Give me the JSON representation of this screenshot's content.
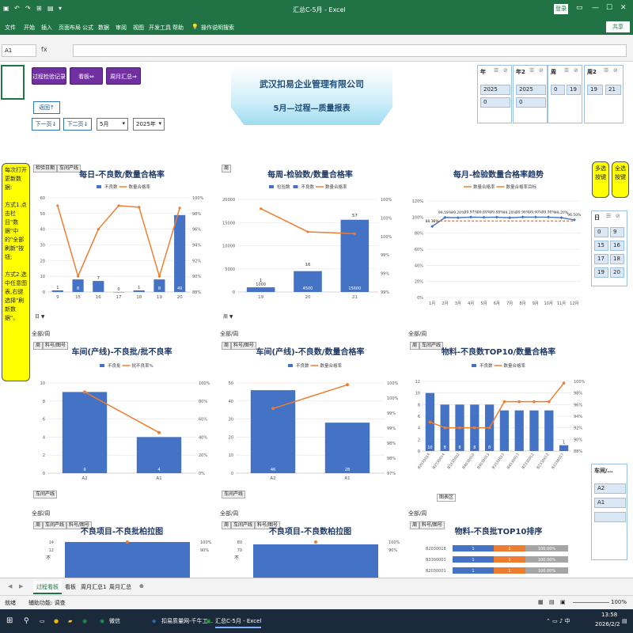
{
  "window": {
    "title": "汇总C-5月 - Excel",
    "login_label": "登录",
    "share_label": "共享"
  },
  "ribbon": {
    "tabs": [
      "文件",
      "开始",
      "插入",
      "页面布局",
      "公式",
      "数据",
      "审阅",
      "视图",
      "开发工具",
      "帮助"
    ],
    "tell_me": "操作说明搜索"
  },
  "formula_bar": {
    "name_box": "A1",
    "fx": "fx",
    "value": ""
  },
  "buttons": {
    "process": "过程检验记录",
    "board": "看板⇔",
    "monthly": "周月汇总⇒",
    "back": "返回↑",
    "next_page": "下一页↓",
    "next_page2": "下二页↓"
  },
  "selects": {
    "month": "5月",
    "year": "2025年"
  },
  "banner": {
    "company": "武汉扣易企业管理有限公司",
    "subtitle": "5月—过程—质量报表"
  },
  "slicers": {
    "year": {
      "header": "年",
      "items": [
        "2025",
        "0"
      ]
    },
    "year2": {
      "header": "年2",
      "items": [
        "2025",
        "0"
      ]
    },
    "week": {
      "header": "周",
      "items": [
        "0",
        "19"
      ]
    },
    "week2": {
      "header": "周2",
      "items": [
        "19",
        "21"
      ]
    },
    "right_week": {
      "header": "日",
      "items": [
        [
          "0",
          "9"
        ],
        [
          "15",
          "16"
        ],
        [
          "17",
          "18"
        ],
        [
          "19",
          "20"
        ]
      ]
    },
    "workshop": {
      "header": "车间/…",
      "items": [
        "A2",
        "A1",
        ""
      ]
    }
  },
  "notes": {
    "left": "每次打开更新数据:\n\n方式1.点击栏目\"数据\"中的\"全部刷新\"按钮;\n\n方式2.选中任意图表,右键选择\"刷新数据\"。",
    "multi": "多选按键",
    "all": "全选按键"
  },
  "field_buttons": {
    "date": "检验日期",
    "workshop": "车间产线",
    "week": "周",
    "material": "料号/图号",
    "all_week": "全部/周"
  },
  "chart_tooltip": "图表区",
  "sheet_tabs": [
    "过程看板",
    "看板",
    "周月汇总1",
    "周月汇总"
  ],
  "active_tab": "过程看板",
  "status": {
    "ready": "就绪",
    "accessibility": "辅助功能: 调查",
    "zoom": "100%"
  },
  "taskbar": {
    "apps": [
      "微信",
      "扣易质量网-千牛工...",
      "汇总C-5月 - Excel"
    ],
    "time": "13:58",
    "date": "2026/2/2"
  },
  "colors": {
    "bar": "#4472c4",
    "line": "#ed7d31",
    "excel_green": "#217346",
    "purple": "#7030a0"
  },
  "chart_data": [
    {
      "type": "bar",
      "title": "每日-不良数/数量合格率",
      "series": [
        {
          "name": "不良数",
          "values": [
            1,
            8,
            7,
            0,
            1,
            8,
            49
          ]
        },
        {
          "name": "数量合格率",
          "values": [
            0.99,
            0.9,
            0.96,
            0.99,
            0.988,
            0.9,
            0.987
          ]
        }
      ],
      "categories": [
        "9",
        "15",
        "16",
        "17",
        "18",
        "19",
        "20"
      ],
      "ylim": [
        0,
        60
      ],
      "y2lim": [
        0.88,
        1.0
      ]
    },
    {
      "type": "bar",
      "title": "每周-检验数/数量合格率",
      "series": [
        {
          "name": "检验数",
          "values": [
            1000,
            4500,
            15600
          ]
        },
        {
          "name": "不良数",
          "values": [
            1,
            16,
            57
          ]
        },
        {
          "name": "数量合格率",
          "values": [
            0.999,
            0.9965,
            0.9963
          ]
        }
      ],
      "categories": [
        "19",
        "20",
        "21"
      ],
      "ylim": [
        0,
        20000
      ],
      "y2lim": [
        0.99,
        1.0
      ]
    },
    {
      "type": "line",
      "title": "每月-检验数量合格率趋势",
      "series": [
        {
          "name": "数量合格率",
          "values": [
            0.8838,
            0.9959,
            0.992,
            0.9997,
            0.9969,
            0.9988,
            0.992,
            0.9996,
            0.999,
            0.999,
            0.992,
            0.965
          ]
        },
        {
          "name": "数量合格率目标",
          "values": [
            0.95,
            0.95,
            0.95,
            0.95,
            0.95,
            0.95,
            0.95,
            0.95,
            0.95,
            0.95,
            0.95,
            0.95
          ]
        }
      ],
      "data_labels": [
        "88.38%",
        "99.59%",
        "99.20%",
        "99.97%",
        "99.69%",
        "99.88%",
        "99.20%",
        "99.96%",
        "99.90%",
        "99.90%",
        "99.20%",
        "96.50%"
      ],
      "categories": [
        "1月",
        "2月",
        "3月",
        "4月",
        "5月",
        "6月",
        "7月",
        "8月",
        "9月",
        "10月",
        "11月",
        "12月"
      ],
      "ylim": [
        0,
        1.2
      ]
    },
    {
      "type": "bar",
      "title": "车间(产线)-不良批/批不良率",
      "series": [
        {
          "name": "不良批",
          "values": [
            9,
            4
          ]
        },
        {
          "name": "批不良率%",
          "values": [
            0.9,
            0.45
          ]
        }
      ],
      "categories": [
        "A2",
        "A1"
      ],
      "ylim": [
        0,
        10
      ],
      "y2lim": [
        0,
        1.0
      ]
    },
    {
      "type": "bar",
      "title": "车间(产线)-不良数/数量合格率",
      "series": [
        {
          "name": "不良数",
          "values": [
            46,
            28
          ]
        },
        {
          "name": "数量合格率",
          "values": [
            0.9915,
            0.9994
          ]
        }
      ],
      "categories": [
        "A2",
        "A1"
      ],
      "ylim": [
        0,
        50
      ],
      "y2lim": [
        0.97,
        1.0
      ]
    },
    {
      "type": "bar",
      "title": "物料-不良数TOP10/数量合格率",
      "series": [
        {
          "name": "不良数",
          "values": [
            10,
            8,
            8,
            8,
            8,
            7,
            7,
            7,
            7,
            1
          ]
        },
        {
          "name": "数量合格率",
          "values": [
            0.93,
            0.92,
            0.92,
            0.92,
            0.92,
            0.965,
            0.965,
            0.965,
            0.965,
            0.997
          ]
        }
      ],
      "data_labels": [
        "10",
        "8",
        "8",
        "8",
        "8",
        "",
        "",
        "",
        "",
        "1"
      ],
      "categories": [
        "B2030014",
        "B2330014",
        "B3330002",
        "B4030010",
        "B4030013",
        "B3330013",
        "B4530013",
        "B3330012",
        "B2330012",
        "B3330017"
      ],
      "ylim": [
        0,
        12
      ],
      "y2lim": [
        0.88,
        1.0
      ]
    },
    {
      "type": "bar",
      "title": "不良项目-不良批柏拉图",
      "series": [
        {
          "name": "不良批",
          "values": [
            14
          ]
        }
      ],
      "categories": [
        ""
      ],
      "ylim": [
        0,
        14
      ]
    },
    {
      "type": "bar",
      "title": "不良项目-不良数柏拉图",
      "series": [
        {
          "name": "不良数",
          "values": [
            74
          ]
        }
      ],
      "categories": [
        ""
      ],
      "ylim": [
        0,
        80
      ]
    },
    {
      "type": "table",
      "title": "物料-不良批TOP10排序",
      "rows": [
        [
          "B2030018",
          "1",
          "1",
          "100.00%"
        ],
        [
          "B3300001",
          "1",
          "1",
          "100.00%"
        ],
        [
          "B2030001",
          "1",
          "1",
          "100.00%"
        ]
      ]
    }
  ]
}
